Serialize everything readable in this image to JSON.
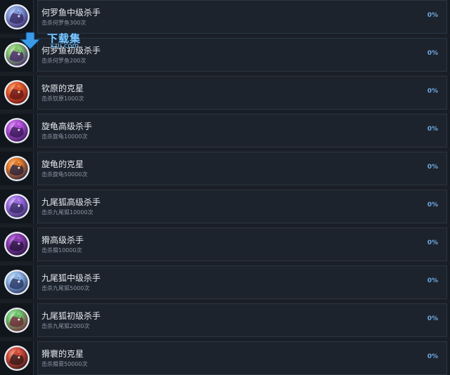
{
  "watermark": {
    "text": "下载集",
    "url": "xzji.com",
    "color": "#7ec8ff"
  },
  "achievements": [
    {
      "title": "何罗鱼中级杀手",
      "desc": "击杀何罗鱼300次",
      "percent": "0%",
      "icon": "monster-icon-blue-purple",
      "colors": [
        "#7f97d8",
        "#3a2b66",
        "#d8e2ff"
      ]
    },
    {
      "title": "何罗鱼初级杀手",
      "desc": "击杀何罗鱼200次",
      "percent": "0%",
      "icon": "monster-icon-green-purple",
      "colors": [
        "#7ec06a",
        "#4a2a6b",
        "#e4f2d0"
      ]
    },
    {
      "title": "钦原的克星",
      "desc": "击杀钦原1000次",
      "percent": "0%",
      "icon": "monster-icon-red-orange",
      "colors": [
        "#e05a2a",
        "#6b1717",
        "#ffd2a8"
      ]
    },
    {
      "title": "旋龟高级杀手",
      "desc": "击杀旋龟10000次",
      "percent": "0%",
      "icon": "monster-icon-purple",
      "colors": [
        "#b14fd6",
        "#3c1a5c",
        "#f0c8ff"
      ]
    },
    {
      "title": "旋龟的克星",
      "desc": "击杀旋龟50000次",
      "percent": "0%",
      "icon": "monster-icon-orange-dark",
      "colors": [
        "#e0782a",
        "#2b2440",
        "#ffd8a8"
      ]
    },
    {
      "title": "九尾狐高级杀手",
      "desc": "击杀九尾狐10000次",
      "percent": "0%",
      "icon": "monster-icon-violet",
      "colors": [
        "#9a6ae0",
        "#3a2c66",
        "#f0e6ff"
      ]
    },
    {
      "title": "猾高级杀手",
      "desc": "击杀猾10000次",
      "percent": "0%",
      "icon": "monster-icon-deep-purple",
      "colors": [
        "#8a3ab0",
        "#2a1540",
        "#d8a8f0"
      ]
    },
    {
      "title": "九尾狐中级杀手",
      "desc": "击杀九尾狐5000次",
      "percent": "0%",
      "icon": "monster-icon-light-blue",
      "colors": [
        "#8ab0e0",
        "#2c3a66",
        "#f0f6ff"
      ]
    },
    {
      "title": "九尾狐初级杀手",
      "desc": "击杀九尾狐2000次",
      "percent": "0%",
      "icon": "monster-icon-green-red",
      "colors": [
        "#6ac06a",
        "#702a3a",
        "#e8ffe0"
      ]
    },
    {
      "title": "猾褱的克星",
      "desc": "击杀猾褱50000次",
      "percent": "0%",
      "icon": "monster-icon-red-brown",
      "colors": [
        "#d04a3a",
        "#3a1a1a",
        "#ffc8b0"
      ]
    }
  ]
}
